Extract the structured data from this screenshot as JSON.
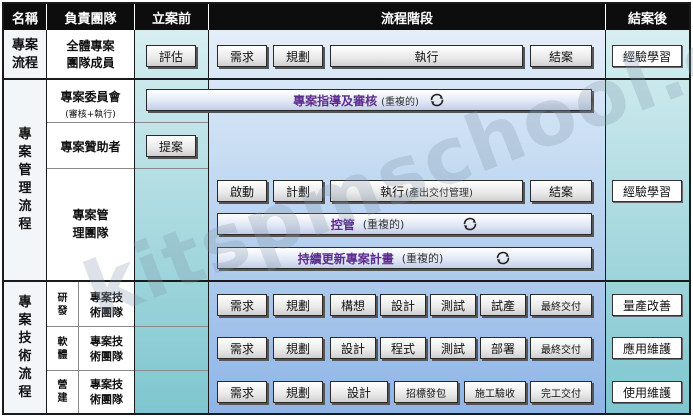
{
  "headers": {
    "name": "名稱",
    "team": "負責團隊",
    "pre": "立案前",
    "process": "流程階段",
    "post": "結案後"
  },
  "row1": {
    "name": "專案\n流程",
    "team": "全體專案\n團隊成員",
    "pre_btn": "評估",
    "steps": [
      "需求",
      "規劃",
      "執行",
      "結案"
    ],
    "post": "經驗學習"
  },
  "mgmt": {
    "name": "專\n案\n管\n理\n流\n程",
    "committee": {
      "team": "專案委員會",
      "team_sub": "(審核+執行)",
      "bar": "專案指導及審核",
      "bar_paren": "(重複的)"
    },
    "sponsor": {
      "team": "專案贊助者",
      "pre_btn": "提案"
    },
    "pmteam": {
      "team": "專案管\n理團隊",
      "steps": [
        "啟動",
        "計劃"
      ],
      "exec": "執行",
      "exec_paren": "(產出交付管理)",
      "close": "結案",
      "control": "控管",
      "control_paren": "(重複的)",
      "update": "持續更新專案計畫",
      "update_paren": "(重複的)",
      "post": "經驗學習"
    }
  },
  "tech": {
    "name": "專\n案\n技\n術\n流\n程",
    "rows": [
      {
        "kind": "研\n發",
        "team": "專案技\n術團隊",
        "steps": [
          "需求",
          "規劃",
          "構想",
          "設計",
          "測試",
          "試產",
          "最終交付"
        ],
        "post": "量產改善"
      },
      {
        "kind": "軟\n體",
        "team": "專案技\n術團隊",
        "steps": [
          "需求",
          "規劃",
          "設計",
          "程式",
          "測試",
          "部署",
          "最終交付"
        ],
        "post": "應用維護"
      },
      {
        "kind": "營\n建",
        "team": "專案技\n術團隊",
        "steps": [
          "需求",
          "規劃",
          "設計",
          "招標發包",
          "施工驗收",
          "完工交付"
        ],
        "post": "使用維護"
      }
    ]
  },
  "watermark": "kitspmschool.com",
  "icons": {
    "cycle": "cycle-icon"
  }
}
